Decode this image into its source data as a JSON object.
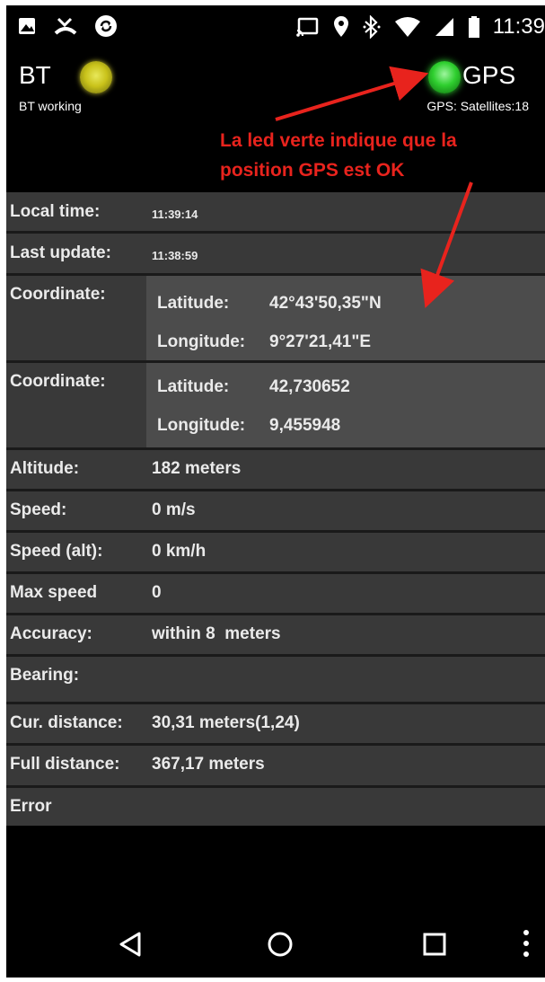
{
  "status_bar": {
    "time": "11:39",
    "left_icons": [
      "image-icon",
      "missed-call-icon",
      "sync-icon"
    ],
    "right_icons": [
      "cast-icon",
      "location-pin-icon",
      "bluetooth-icon",
      "wifi-icon",
      "signal-icon",
      "battery-icon"
    ]
  },
  "header": {
    "bt_label": "BT",
    "bt_status": "BT working",
    "bt_led_color": "#c9c21a",
    "gps_label": "GPS",
    "gps_status": "GPS: Satellites:18",
    "gps_led_color": "#2fcf2f"
  },
  "annotation": {
    "line1": "La led verte indique que la",
    "line2": "position GPS est OK",
    "color": "#e8231d"
  },
  "rows": {
    "local_time": {
      "label": "Local time:",
      "value": "11:39:14"
    },
    "last_update": {
      "label": "Last update:",
      "value": "11:38:59"
    },
    "coord_dms": {
      "label": "Coordinate:",
      "lat_label": "Latitude:",
      "lat_value": "42°43'50,35\"N",
      "lon_label": "Longitude:",
      "lon_value": "9°27'21,41\"E"
    },
    "coord_dec": {
      "label": "Coordinate:",
      "lat_label": "Latitude:",
      "lat_value": "42,730652",
      "lon_label": "Longitude:",
      "lon_value": "9,455948"
    },
    "altitude": {
      "label": "Altitude:",
      "value": "182 meters"
    },
    "speed": {
      "label": "Speed:",
      "value": "0 m/s"
    },
    "speed_alt": {
      "label": "Speed (alt):",
      "value": "0 km/h"
    },
    "max_speed": {
      "label": "Max speed",
      "value": "0"
    },
    "accuracy": {
      "label": "Accuracy:",
      "value": "within 8  meters"
    },
    "bearing": {
      "label": "Bearing:",
      "value": ""
    },
    "cur_distance": {
      "label": "Cur. distance:",
      "value": "30,31 meters(1,24)"
    },
    "full_distance": {
      "label": "Full distance:",
      "value": "367,17 meters"
    },
    "error": {
      "label": "Error",
      "value": ""
    }
  },
  "nav": {
    "icons": [
      "back-icon",
      "home-icon",
      "recents-icon",
      "overflow-menu-icon"
    ]
  }
}
